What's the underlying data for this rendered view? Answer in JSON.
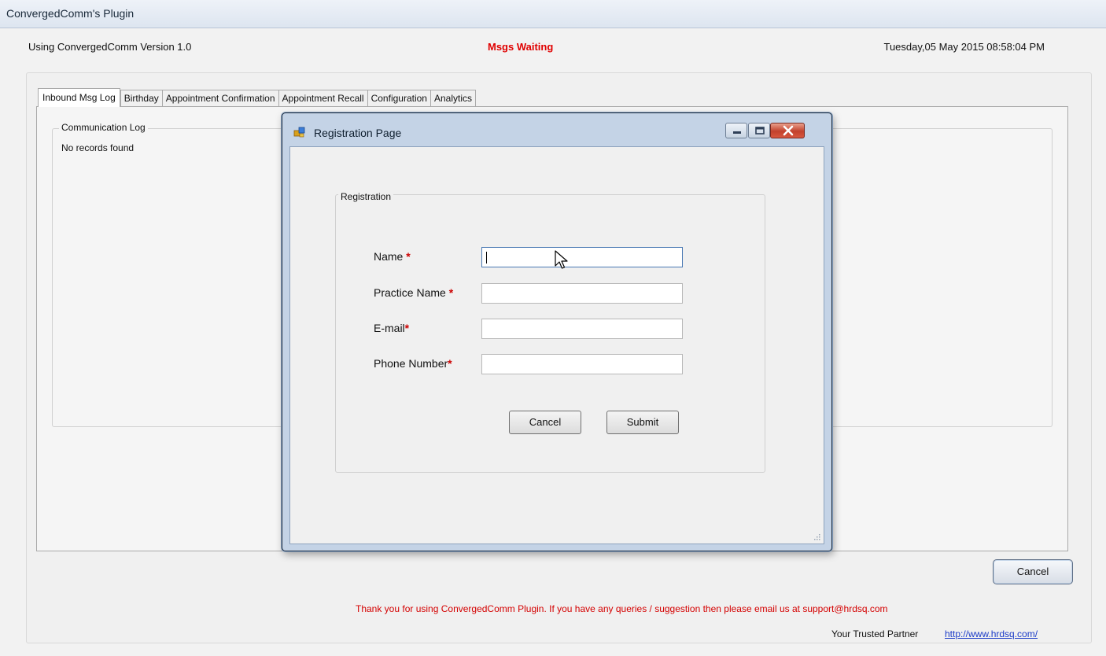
{
  "window": {
    "title": "ConvergedComm's Plugin"
  },
  "header": {
    "version_text": "Using ConvergedComm Version 1.0",
    "status_text": "Msgs Waiting",
    "datetime_text": "Tuesday,05 May 2015 08:58:04 PM"
  },
  "tabs": [
    {
      "label": "Inbound Msg Log",
      "active": true
    },
    {
      "label": "Birthday"
    },
    {
      "label": "Appointment Confirmation"
    },
    {
      "label": "Appointment Recall"
    },
    {
      "label": "Configuration"
    },
    {
      "label": "Analytics"
    }
  ],
  "comm_log": {
    "title": "Communication Log",
    "empty_text": "No records found"
  },
  "dialog": {
    "title": "Registration Page",
    "group_title": "Registration",
    "required_marker": "*",
    "fields": [
      {
        "label": "Name",
        "value": ""
      },
      {
        "label": "Practice Name",
        "value": ""
      },
      {
        "label": "E-mail",
        "value": ""
      },
      {
        "label": "Phone Number",
        "value": ""
      }
    ],
    "cancel_label": "Cancel",
    "submit_label": "Submit"
  },
  "footer": {
    "cancel_label": "Cancel",
    "thanks_text": "Thank you for using ConvergedComm Plugin. If you have any queries / suggestion then please email us at support@hrdsq.com",
    "trusted_text": "Your Trusted Partner",
    "link_text": "http://www.hrdsq.com/"
  },
  "colors": {
    "status_red": "#e00000",
    "link_blue": "#1c3cc8",
    "dialog_frame": "#c4d3e6"
  },
  "icons": [
    "app-icon",
    "minimize-icon",
    "maximize-icon",
    "close-icon",
    "resize-grip-icon",
    "mouse-pointer-icon"
  ]
}
